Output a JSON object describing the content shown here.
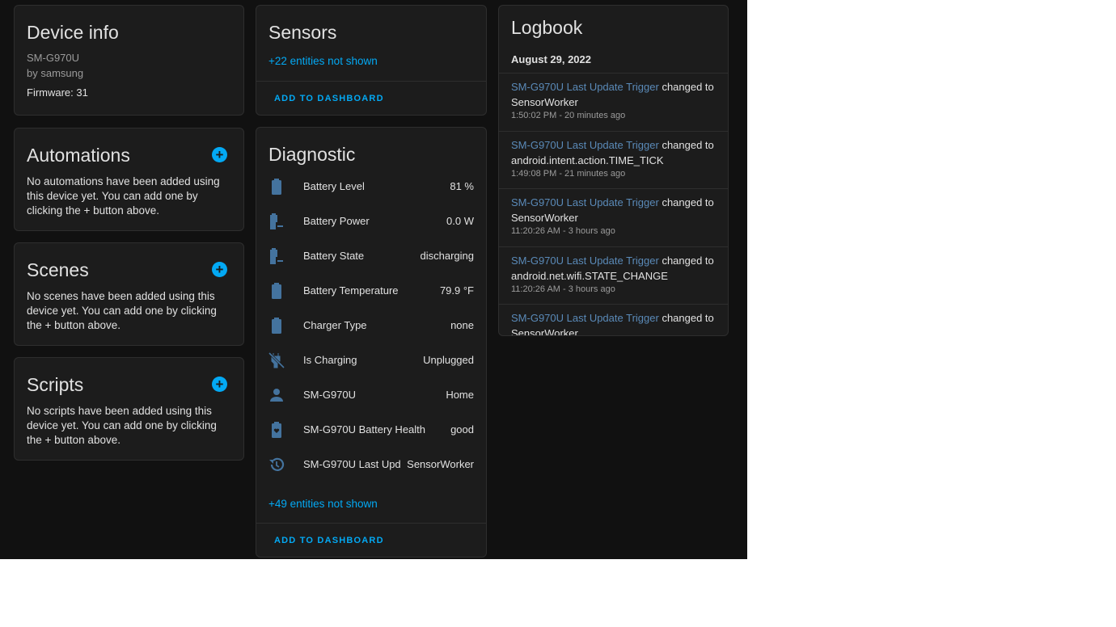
{
  "device_info": {
    "title": "Device info",
    "model": "SM-G970U",
    "manufacturer": "by samsung",
    "firmware": "Firmware: 31"
  },
  "automations": {
    "title": "Automations",
    "text": "No automations have been added using this device yet. You can add one by clicking the + button above."
  },
  "scenes": {
    "title": "Scenes",
    "text": "No scenes have been added using this device yet. You can add one by clicking the + button above."
  },
  "scripts": {
    "title": "Scripts",
    "text": "No scripts have been added using this device yet. You can add one by clicking the + button above."
  },
  "sensors": {
    "title": "Sensors",
    "hidden": "+22 entities not shown",
    "action": "ADD TO DASHBOARD"
  },
  "diagnostic": {
    "title": "Diagnostic",
    "hidden": "+49 entities not shown",
    "action": "ADD TO DASHBOARD",
    "rows": [
      {
        "icon": "battery-icon",
        "name": "Battery Level",
        "value": "81 %"
      },
      {
        "icon": "battery-minus-icon",
        "name": "Battery Power",
        "value": "0.0 W"
      },
      {
        "icon": "battery-minus-icon",
        "name": "Battery State",
        "value": "discharging"
      },
      {
        "icon": "battery-icon",
        "name": "Battery Temperature",
        "value": "79.9 °F"
      },
      {
        "icon": "battery-icon",
        "name": "Charger Type",
        "value": "none"
      },
      {
        "icon": "power-plug-off-icon",
        "name": "Is Charging",
        "value": "Unplugged"
      },
      {
        "icon": "account-icon",
        "name": "SM-G970U",
        "value": "Home"
      },
      {
        "icon": "battery-heart-icon",
        "name": "SM-G970U Battery Health",
        "value": "good"
      },
      {
        "icon": "history-icon",
        "name": "SM-G970U Last Upd…",
        "value": "SensorWorker"
      }
    ]
  },
  "logbook": {
    "title": "Logbook",
    "date": "August 29, 2022",
    "entries": [
      {
        "entity": "SM-G970U Last Update Trigger",
        "verb": "changed to",
        "state": "SensorWorker",
        "time": "1:50:02 PM - 20 minutes ago"
      },
      {
        "entity": "SM-G970U Last Update Trigger",
        "verb": "changed to",
        "state": "android.intent.action.TIME_TICK",
        "time": "1:49:08 PM - 21 minutes ago"
      },
      {
        "entity": "SM-G970U Last Update Trigger",
        "verb": "changed to",
        "state": "SensorWorker",
        "time": "11:20:26 AM - 3 hours ago"
      },
      {
        "entity": "SM-G970U Last Update Trigger",
        "verb": "changed to",
        "state": "android.net.wifi.STATE_CHANGE",
        "time": "11:20:26 AM - 3 hours ago"
      },
      {
        "entity": "SM-G970U Last Update Trigger",
        "verb": "changed to",
        "state": "SensorWorker",
        "time": ""
      }
    ]
  },
  "colors": {
    "accent": "#03a9f4",
    "icon": "#44739e",
    "link": "#5a8ab8",
    "card": "#1c1c1c",
    "background": "#111111"
  }
}
